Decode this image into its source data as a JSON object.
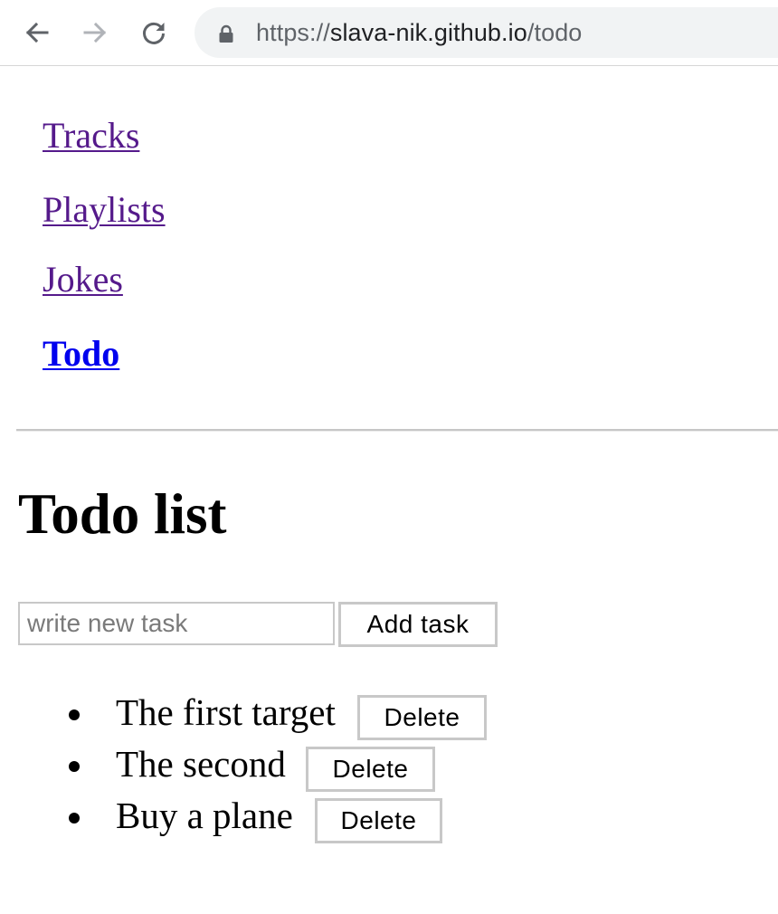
{
  "browser": {
    "url": {
      "scheme": "https://",
      "host": "slava-nik.github.io",
      "path": "/todo"
    },
    "icons": {
      "back": "arrow-left-icon",
      "forward": "arrow-right-icon",
      "reload": "reload-icon",
      "secure": "lock-icon"
    },
    "colors": {
      "icon_active": "#5f6368",
      "icon_disabled": "#b0b3b8",
      "omnibox_bg": "#f1f3f4"
    }
  },
  "nav": {
    "links": [
      {
        "label": "Tracks",
        "state": "visited"
      },
      {
        "label": "Playlists",
        "state": "visited"
      },
      {
        "label": "Jokes",
        "state": "visited"
      },
      {
        "label": "Todo",
        "state": "active"
      }
    ],
    "colors": {
      "visited": "#551a8b",
      "active": "#0000ee"
    }
  },
  "todo": {
    "title": "Todo list",
    "input": {
      "placeholder": "write new task",
      "value": ""
    },
    "add_label": "Add task",
    "items": [
      {
        "text": "The first target",
        "delete_label": "Delete"
      },
      {
        "text": "The second",
        "delete_label": "Delete"
      },
      {
        "text": "Buy a plane",
        "delete_label": "Delete"
      }
    ]
  }
}
